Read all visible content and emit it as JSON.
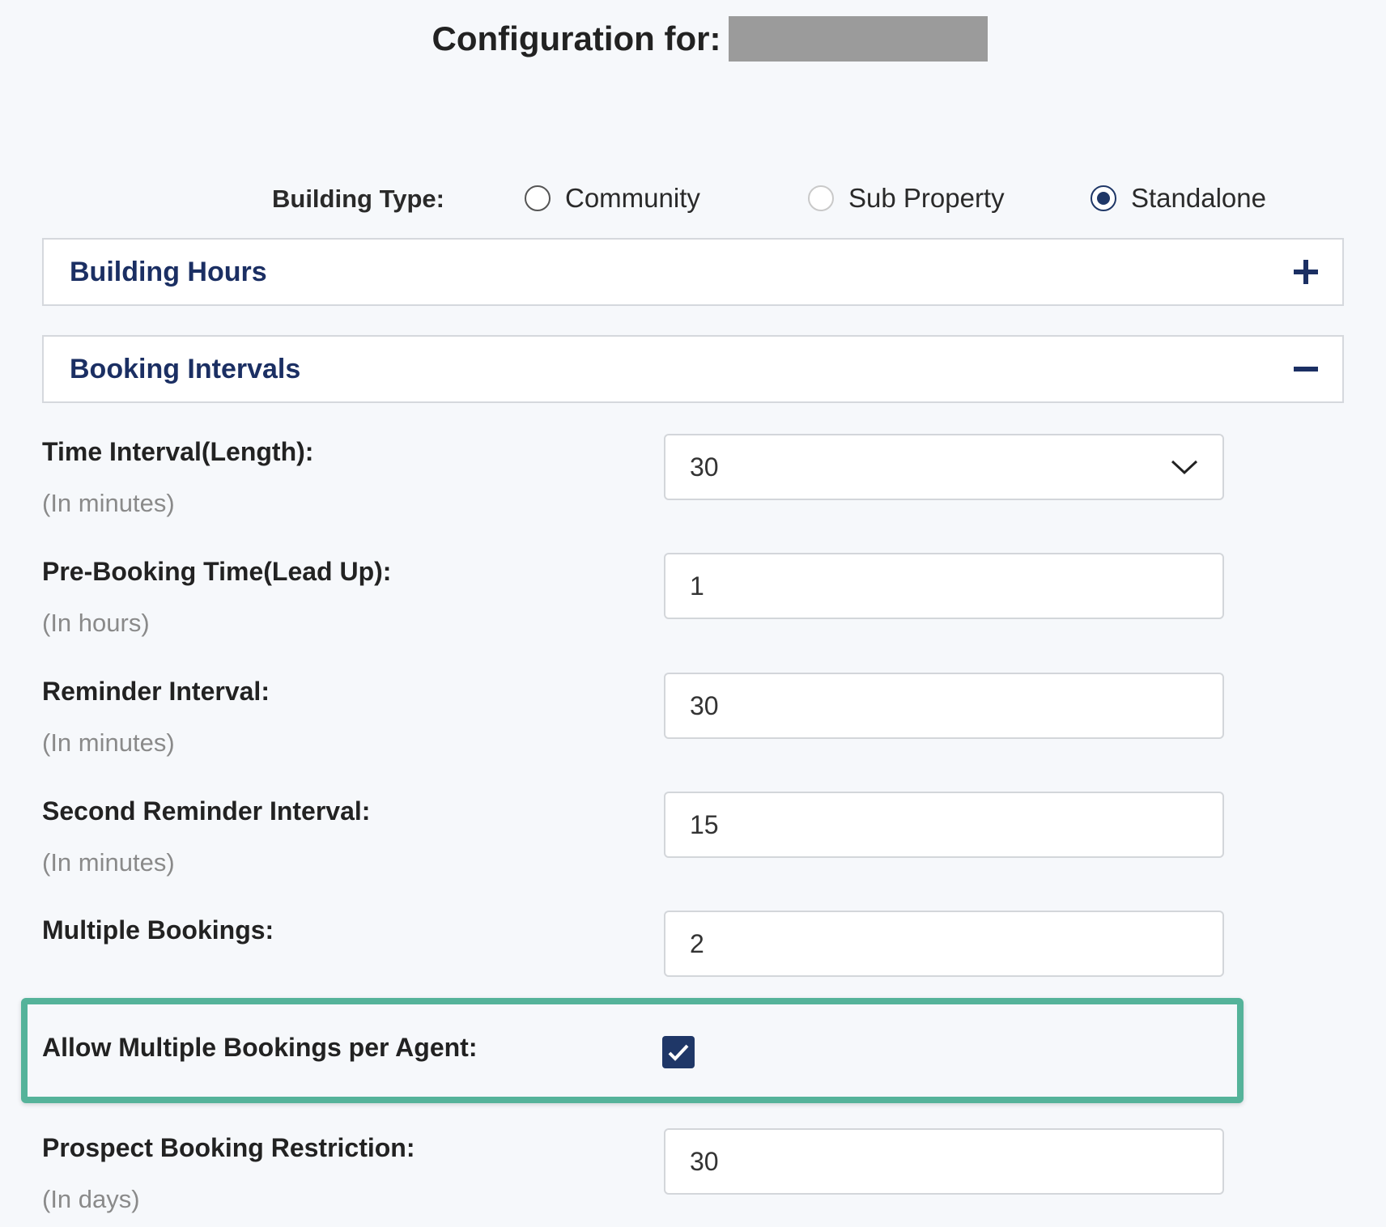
{
  "header": {
    "title": "Configuration for:"
  },
  "building_type": {
    "label": "Building Type:",
    "options": [
      {
        "label": "Community",
        "state": "unselected"
      },
      {
        "label": "Sub Property",
        "state": "disabled"
      },
      {
        "label": "Standalone",
        "state": "selected"
      }
    ]
  },
  "accordions": [
    {
      "title": "Building Hours",
      "icon": "plus-icon",
      "expanded": false
    },
    {
      "title": "Booking Intervals",
      "icon": "minus-icon",
      "expanded": true
    }
  ],
  "fields": {
    "time_interval": {
      "label": "Time Interval(Length):",
      "sub": "(In minutes)",
      "value": "30"
    },
    "pre_booking": {
      "label": "Pre-Booking Time(Lead Up):",
      "sub": "(In hours)",
      "value": "1"
    },
    "reminder": {
      "label": "Reminder Interval:",
      "sub": "(In minutes)",
      "value": "30"
    },
    "second_reminder": {
      "label": "Second Reminder Interval:",
      "sub": "(In minutes)",
      "value": "15"
    },
    "multiple_bookings": {
      "label": "Multiple Bookings:",
      "value": "2"
    },
    "allow_multiple": {
      "label": "Allow Multiple Bookings per Agent:",
      "checked": true
    },
    "prospect_restriction": {
      "label": "Prospect Booking Restriction:",
      "sub": "(In days)",
      "value": "30"
    }
  },
  "colors": {
    "accent": "#1b2f63",
    "highlight": "#55b39a",
    "background": "#f6f8fb"
  }
}
